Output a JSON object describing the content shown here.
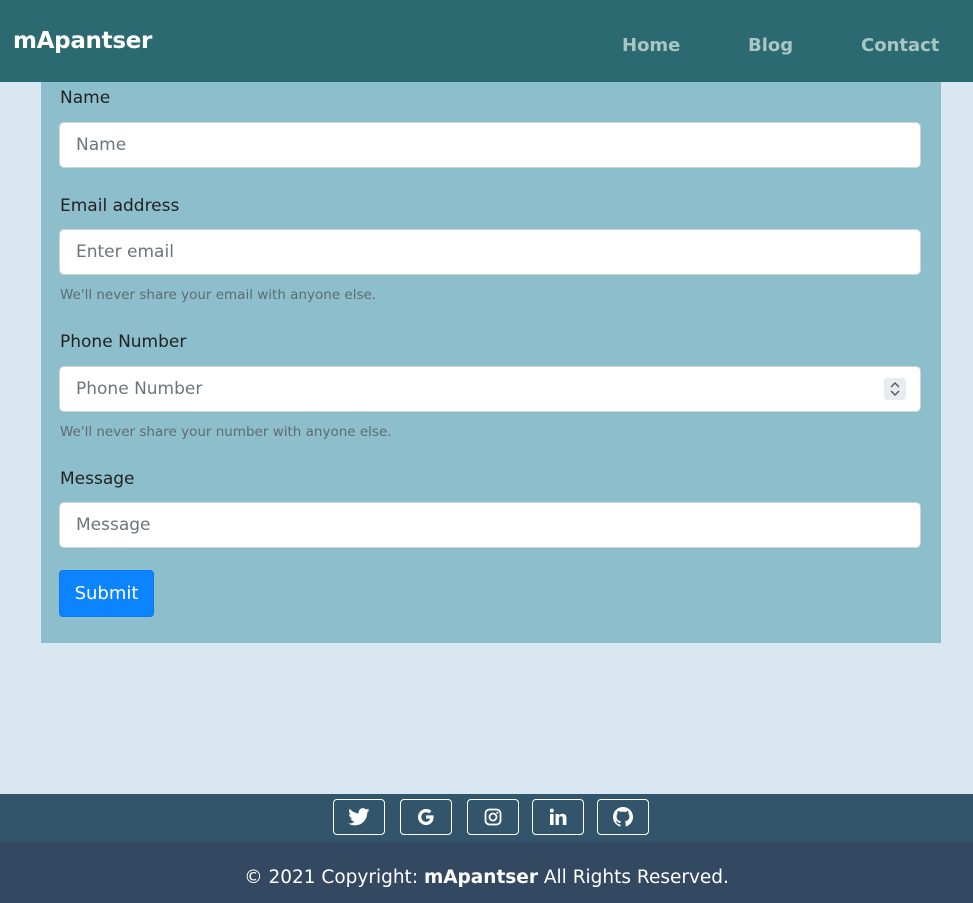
{
  "navbar": {
    "brand": "mApantser",
    "links": [
      "Home",
      "Blog",
      "Contact"
    ]
  },
  "form": {
    "name": {
      "label": "Name",
      "placeholder": "Name"
    },
    "email": {
      "label": "Email address",
      "placeholder": "Enter email",
      "help": "We'll never share your email with anyone else."
    },
    "phone": {
      "label": "Phone Number",
      "placeholder": "Phone Number",
      "help": "We'll never share your number with anyone else."
    },
    "message": {
      "label": "Message",
      "placeholder": "Message"
    },
    "submit_label": "Submit"
  },
  "social": {
    "icons": [
      "twitter-icon",
      "google-icon",
      "instagram-icon",
      "linkedin-icon",
      "github-icon"
    ]
  },
  "footer": {
    "prefix": "© 2021 Copyright:",
    "brand": "mApantser",
    "suffix": "All Rights Reserved."
  },
  "colors": {
    "navbar": "#2c6a71",
    "form_panel": "#8dbecc",
    "page_bg": "#d9e8f0",
    "submit": "#0d84ff",
    "social_bar": "#33556b",
    "footer": "#334861"
  }
}
